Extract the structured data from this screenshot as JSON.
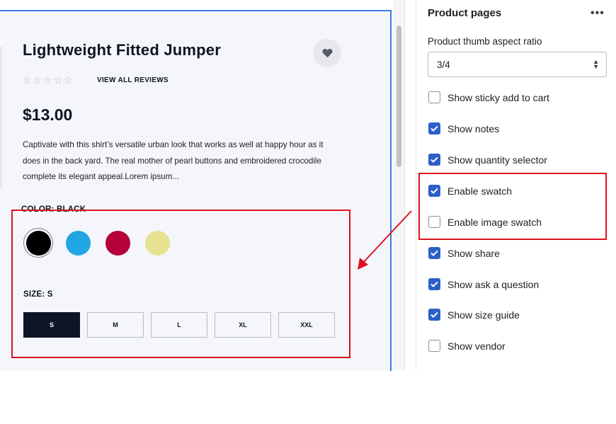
{
  "product": {
    "title": "Lightweight Fitted Jumper",
    "reviews_link": "VIEW ALL REVIEWS",
    "stars": [
      "☆",
      "☆",
      "☆",
      "☆",
      "☆"
    ],
    "price": "$13.00",
    "description": "Captivate with this shirt’s versatile urban look that works as well at happy hour as it does in the back yard. The real mother of pearl buttons and embroidered crocodile complete its elegant appeal.Lorem ipsum...",
    "color_label": "COLOR: BLACK",
    "colors": [
      {
        "name": "black",
        "hex": "#000000",
        "selected": true
      },
      {
        "name": "blue",
        "hex": "#22a6e3",
        "selected": false
      },
      {
        "name": "crimson",
        "hex": "#b5003a",
        "selected": false
      },
      {
        "name": "khaki",
        "hex": "#e6e28f",
        "selected": false
      }
    ],
    "size_label": "SIZE: S",
    "sizes": [
      {
        "label": "S",
        "active": true
      },
      {
        "label": "M",
        "active": false
      },
      {
        "label": "L",
        "active": false
      },
      {
        "label": "XL",
        "active": false
      },
      {
        "label": "XXL",
        "active": false
      }
    ]
  },
  "settings": {
    "title": "Product pages",
    "more_icon": "•••",
    "aspect_label": "Product thumb aspect ratio",
    "aspect_value": "3/4",
    "select_arrows": "▲\n▼",
    "options": [
      {
        "label": "Show sticky add to cart",
        "checked": false
      },
      {
        "label": "Show notes",
        "checked": true
      },
      {
        "label": "Show quantity selector",
        "checked": true
      },
      {
        "label": "Enable swatch",
        "checked": true
      },
      {
        "label": "Enable image swatch",
        "checked": false
      },
      {
        "label": "Show share",
        "checked": true
      },
      {
        "label": "Show ask a question",
        "checked": true
      },
      {
        "label": "Show size guide",
        "checked": true
      },
      {
        "label": "Show vendor",
        "checked": false
      }
    ]
  },
  "colors": {
    "accent": "#2c5fc8",
    "highlight": "#e01020",
    "selection_border": "#3a7be0"
  }
}
